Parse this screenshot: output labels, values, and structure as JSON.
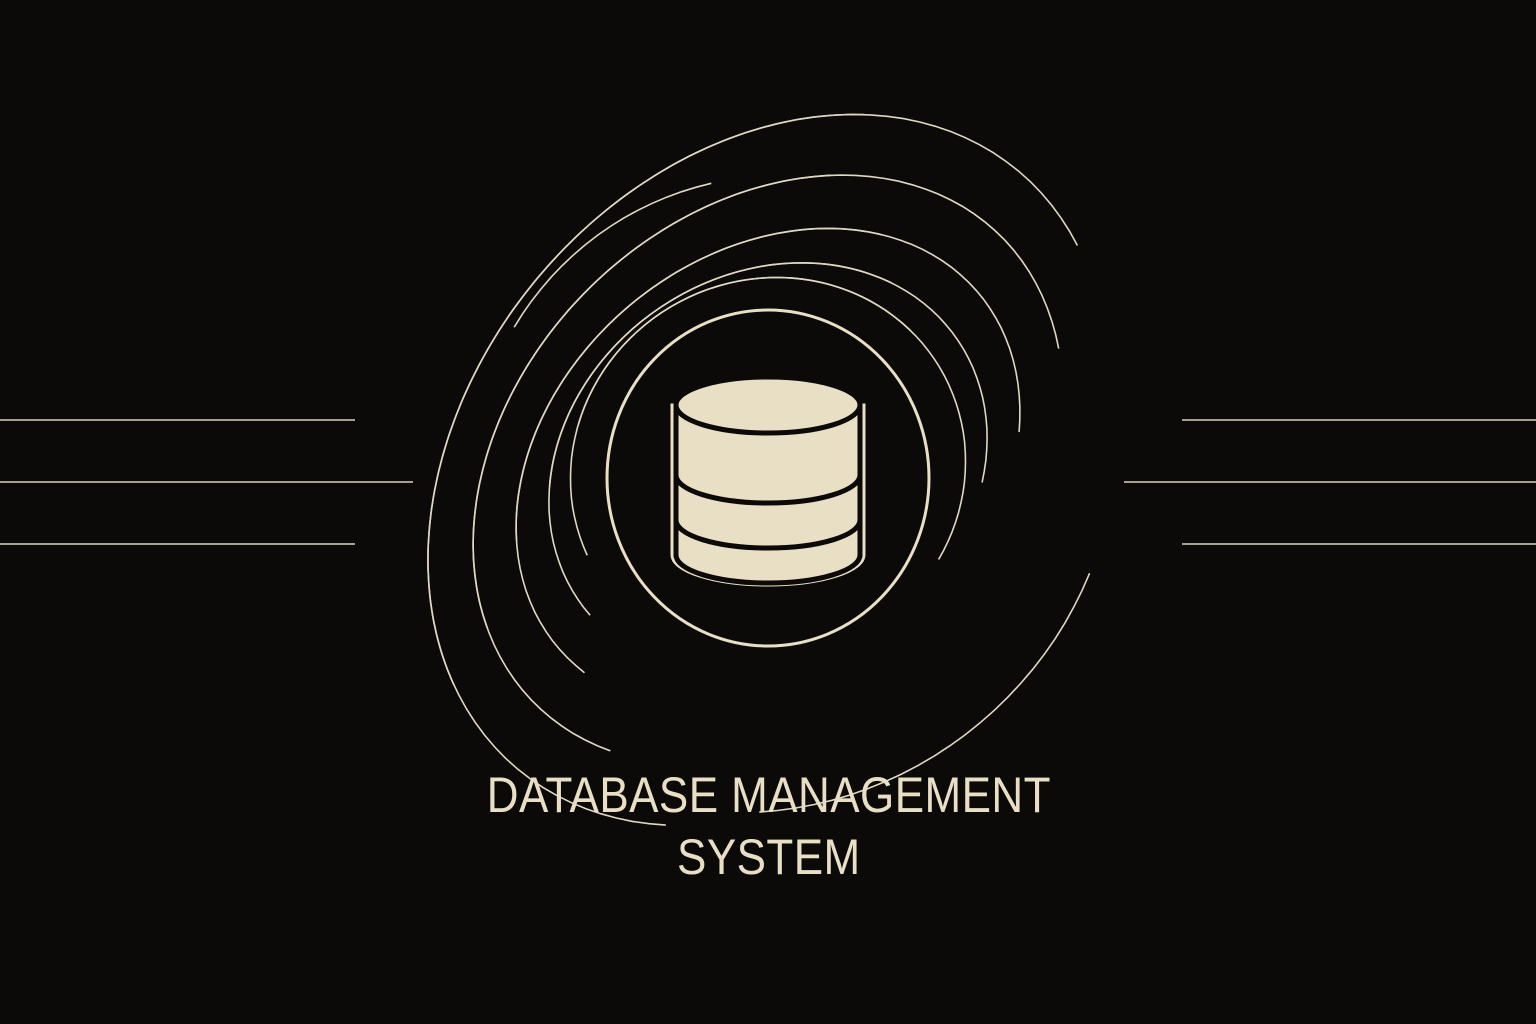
{
  "title": {
    "line1": "DATABASE MANAGEMENT",
    "line2": "SYSTEM"
  },
  "icon": "database-cylinder-icon",
  "colors": {
    "background": "#0b0a09",
    "accent": "#e8dfc4",
    "lines": "#d9d2c0"
  }
}
